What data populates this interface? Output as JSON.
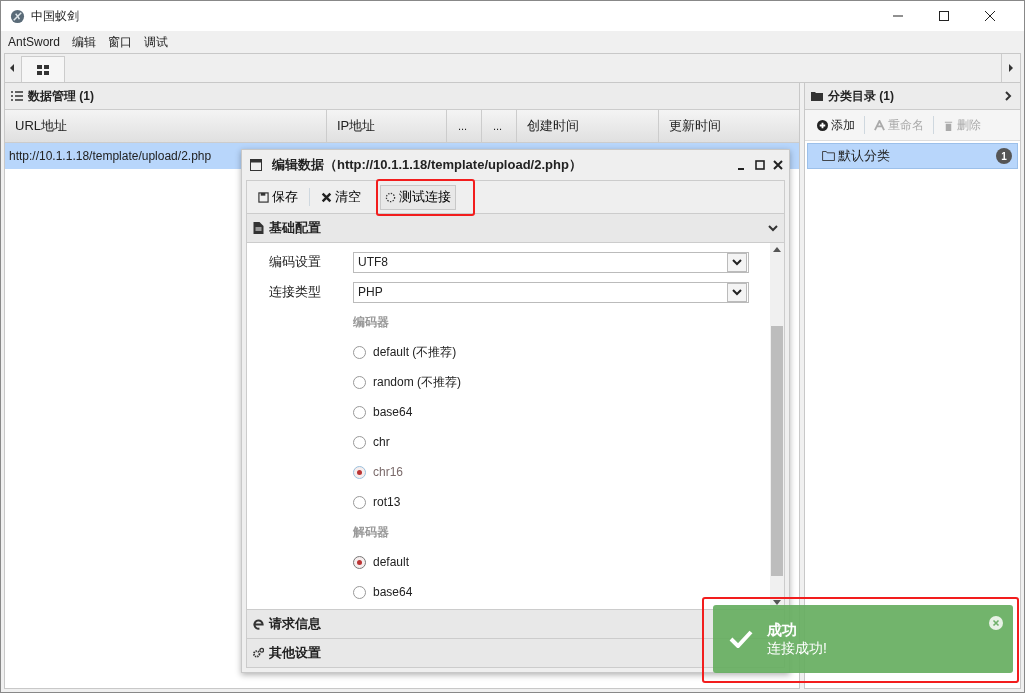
{
  "window": {
    "title": "中国蚁剑"
  },
  "menu": [
    "AntSword",
    "编辑",
    "窗口",
    "调试"
  ],
  "data_panel": {
    "title": "数据管理 (1)",
    "columns": [
      "URL地址",
      "IP地址",
      "...",
      "...",
      "创建时间",
      "更新时间"
    ],
    "rows": [
      {
        "url": "http://10.1.1.18/template/upload/2.php",
        "selected": true
      }
    ]
  },
  "category_panel": {
    "title": "分类目录 (1)",
    "toolbar": [
      {
        "label": "添加",
        "disabled": false
      },
      {
        "label": "重命名",
        "disabled": true
      },
      {
        "label": "删除",
        "disabled": true
      }
    ],
    "items": [
      {
        "label": "默认分类",
        "count": "1",
        "selected": true
      }
    ]
  },
  "dialog": {
    "title": "编辑数据（http://10.1.1.18/template/upload/2.php）",
    "toolbar": [
      {
        "label": "保存",
        "kind": "save"
      },
      {
        "label": "清空",
        "kind": "clear"
      },
      {
        "label": "测试连接",
        "kind": "test"
      }
    ],
    "sections": [
      {
        "title": "基础配置",
        "expanded": true,
        "kind": "basic"
      },
      {
        "title": "请求信息",
        "expanded": false,
        "kind": "request"
      },
      {
        "title": "其他设置",
        "expanded": false,
        "kind": "other"
      }
    ],
    "fields": [
      {
        "label": "编码设置",
        "value": "UTF8"
      },
      {
        "label": "连接类型",
        "value": "PHP"
      }
    ],
    "groups": [
      {
        "title": "编码器",
        "options": [
          {
            "label": "default (不推荐)",
            "selected": false,
            "focused": false
          },
          {
            "label": "random (不推荐)",
            "selected": false,
            "focused": false
          },
          {
            "label": "base64",
            "selected": false,
            "focused": false
          },
          {
            "label": "chr",
            "selected": false,
            "focused": false
          },
          {
            "label": "chr16",
            "selected": true,
            "focused": true
          },
          {
            "label": "rot13",
            "selected": false,
            "focused": false
          }
        ]
      },
      {
        "title": "解码器",
        "options": [
          {
            "label": "default",
            "selected": true,
            "focused": false
          },
          {
            "label": "base64",
            "selected": false,
            "focused": false
          }
        ]
      }
    ]
  },
  "toast": {
    "title": "成功",
    "message": "连接成功!"
  }
}
